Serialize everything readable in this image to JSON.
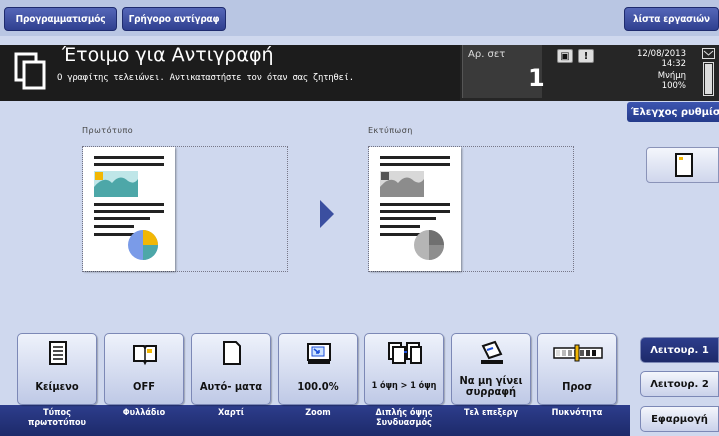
{
  "top": {
    "programming_label": "Προγραμματισμός",
    "quick_copy_label": "Γρήγορο αντίγραφ",
    "job_list_label": "λίστα εργασιών"
  },
  "status": {
    "title": "Έτοιμο για Αντιγραφή",
    "message": "Ο γραφίτης τελειώνει. Αντικαταστήστε τον όταν σας ζητηθεί.",
    "sets_label": "Αρ. σετ",
    "sets_value": "1",
    "date": "12/08/2013",
    "time": "14:32",
    "memory_label": "Μνήμη",
    "memory_value": "100%",
    "memory_level": 1.0,
    "check_settings_label": "Έλεγχος ρυθμίσεων"
  },
  "preview": {
    "original_label": "Πρωτότυπο",
    "output_label": "Εκτύπωση"
  },
  "function_keys": [
    {
      "value": "Κείμενο",
      "caption": "Τύπος πρωτοτύπου",
      "icon": "text-doc-icon"
    },
    {
      "value": "OFF",
      "caption": "Φυλλάδιο",
      "icon": "booklet-icon"
    },
    {
      "value": "Αυτό- ματα",
      "caption": "Χαρτί",
      "icon": "paper-icon"
    },
    {
      "value": "100.0%",
      "caption": "Zoom",
      "icon": "zoom-icon"
    },
    {
      "value": "1 όψη > 1 όψη",
      "caption": "Διπλής όψης Συνδυασμός",
      "icon": "duplex-icon"
    },
    {
      "value": "Να μη γίνει συρραφή",
      "caption": "Τελ επεξεργ",
      "icon": "finishing-icon"
    },
    {
      "value": "Προσ",
      "caption": "Πυκνότητα",
      "icon": "density-icon"
    }
  ],
  "modes": {
    "function1": "Λειτουρ. 1",
    "function2": "Λειτουρ. 2",
    "apply": "Εφαρμογή"
  },
  "colors": {
    "accent": "#2f3f8f",
    "chart_teal": "#4da7a8",
    "chart_yellow": "#f2b705",
    "chart_blue": "#7a9be8"
  }
}
